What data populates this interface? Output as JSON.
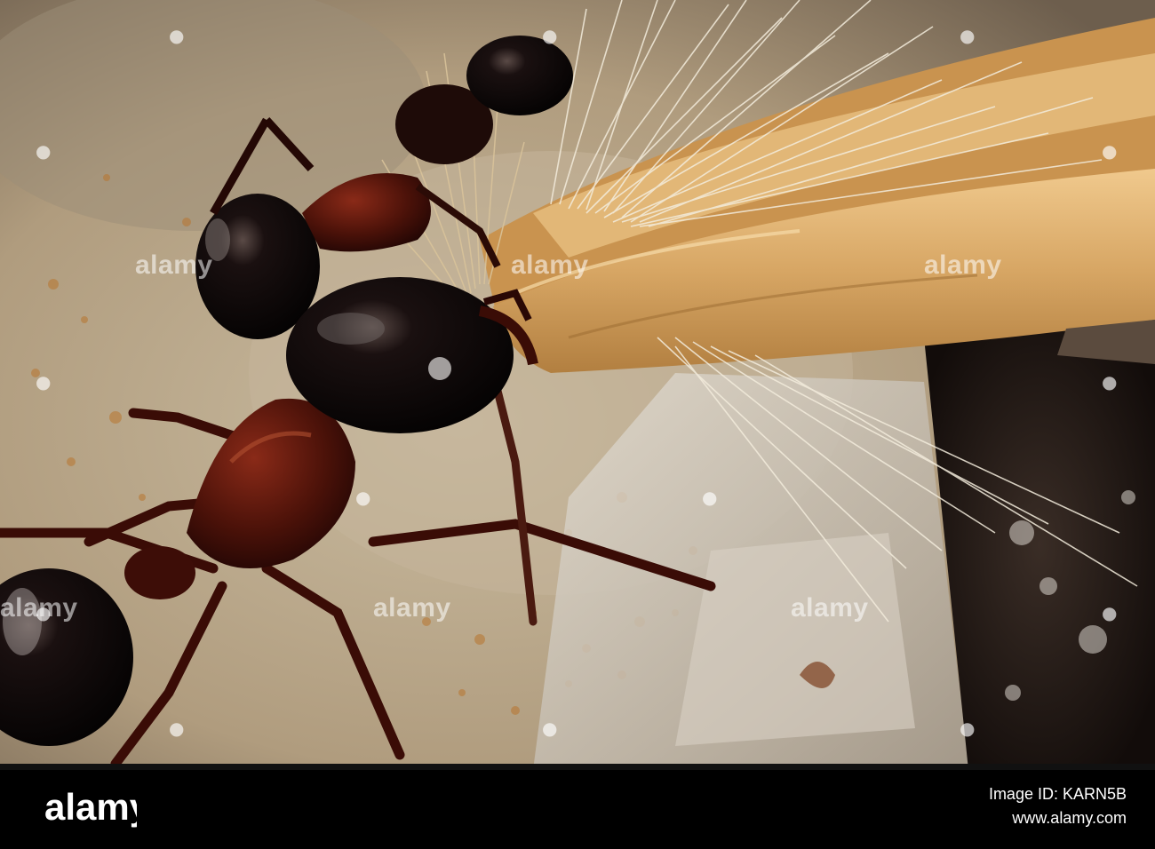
{
  "photo": {
    "subject_colors": {
      "ground": "#b8aa90",
      "seed_husk": "#d9a867",
      "awn_hairs": "#f1ead8",
      "ant_gaster": "#0b0606",
      "ant_thorax": "#4a0f08",
      "shadow": "#2a221c"
    }
  },
  "watermark": {
    "text": "alamy",
    "dot_icon": "alamy-a-icon"
  },
  "footer": {
    "brand": "alamy",
    "image_id": "Image ID: KARN5B",
    "website": "www.alamy.com"
  }
}
